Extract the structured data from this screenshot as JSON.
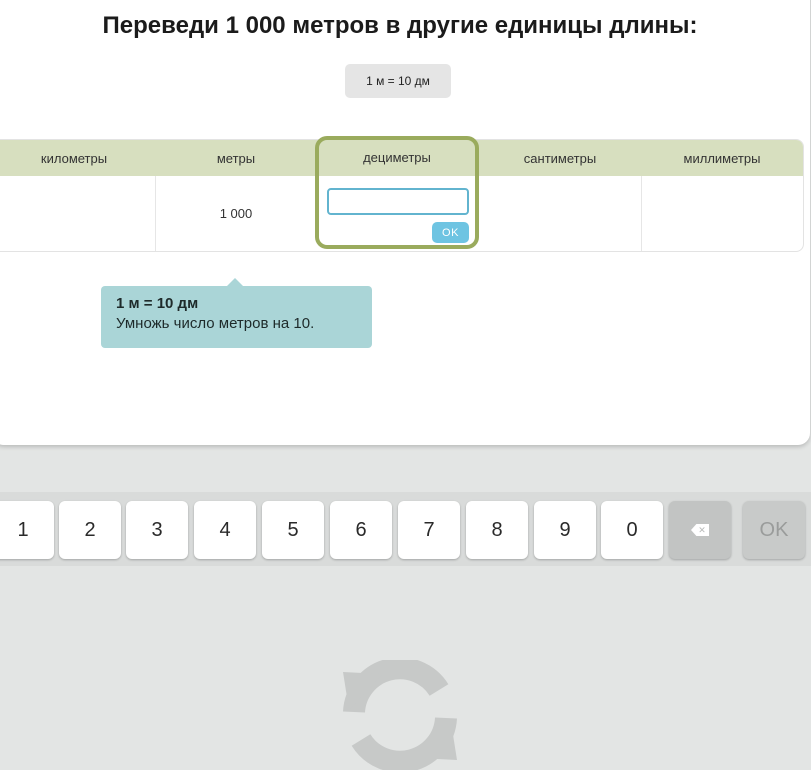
{
  "title": "Переведи 1 000 метров в другие единицы длины:",
  "hint_chip": "1 м = 10 дм",
  "table": {
    "columns": [
      "километры",
      "метры",
      "дециметры",
      "сантиметры",
      "миллиметры"
    ],
    "values": [
      "",
      "1 000",
      "",
      "",
      ""
    ],
    "active_column": "дециметры"
  },
  "answer_input": {
    "value": "",
    "ok_label": "OK"
  },
  "tooltip": {
    "title": "1 м = 10 дм",
    "text": "Умножь число метров на 10."
  },
  "keyboard": {
    "digits": [
      "1",
      "2",
      "3",
      "4",
      "5",
      "6",
      "7",
      "8",
      "9",
      "0"
    ],
    "backspace_icon": "backspace-icon",
    "ok_label": "OK"
  },
  "icons": {
    "refresh": "refresh-icon"
  },
  "colors": {
    "header_bg": "#d7dfbf",
    "focus_border": "#9aab5d",
    "tooltip_bg": "#aad5d7",
    "ok_button": "#6ec4e2",
    "input_border": "#62b4cf"
  }
}
